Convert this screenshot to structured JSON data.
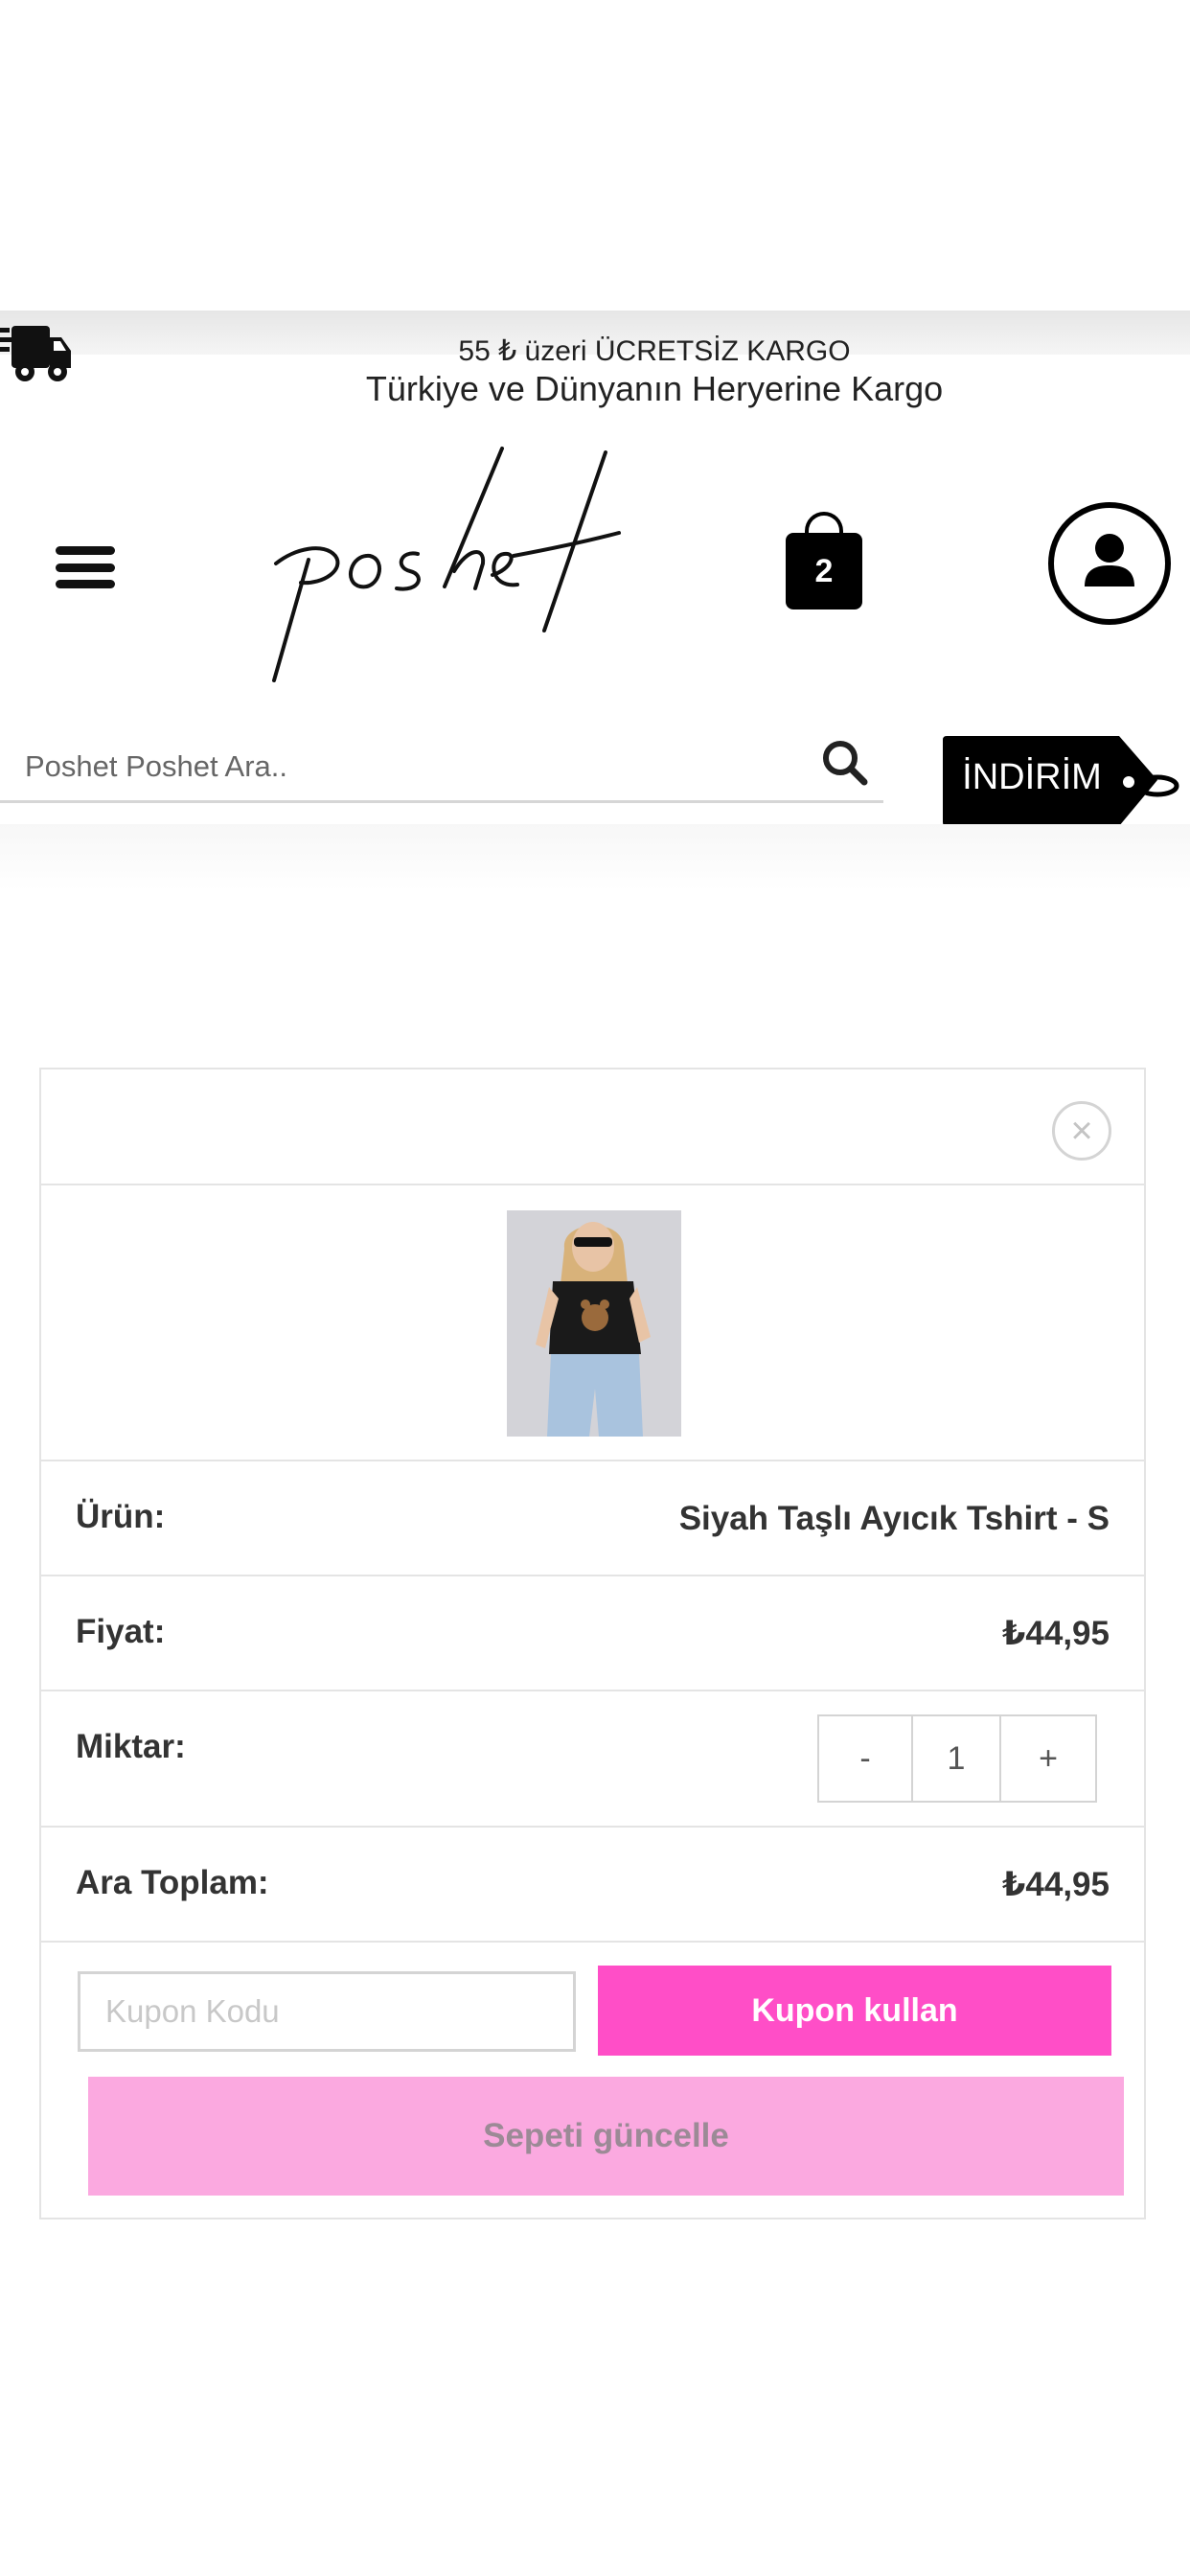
{
  "promo": {
    "line1": "55 ₺ üzeri ÜCRETSİZ KARGO",
    "line2": "Türkiye ve Dünyanın Heryerine Kargo",
    "icon": "truck-icon"
  },
  "header": {
    "menu_icon": "hamburger-icon",
    "logo_text": "poshet",
    "cart_count": "2",
    "account_icon": "user-icon"
  },
  "search": {
    "placeholder": "Poshet Poshet Ara..",
    "icon": "search-icon"
  },
  "sale_tag": {
    "label": "İNDİRİM"
  },
  "cart_item": {
    "remove_label": "×",
    "product_label": "Ürün:",
    "product_name": "Siyah Taşlı Ayıcık Tshirt - S",
    "price_label": "Fiyat:",
    "price": "₺44,95",
    "quantity_label": "Miktar:",
    "quantity_minus": "-",
    "quantity": "1",
    "quantity_plus": "+",
    "subtotal_label": "Ara Toplam:",
    "subtotal": "₺44,95"
  },
  "coupon": {
    "placeholder": "Kupon Kodu",
    "apply_label": "Kupon kullan"
  },
  "update_cart_label": "Sepeti güncelle",
  "colors": {
    "accent_pink": "#ff4ec7",
    "disabled_pink": "#fba9e0",
    "text_dark": "#333333"
  }
}
